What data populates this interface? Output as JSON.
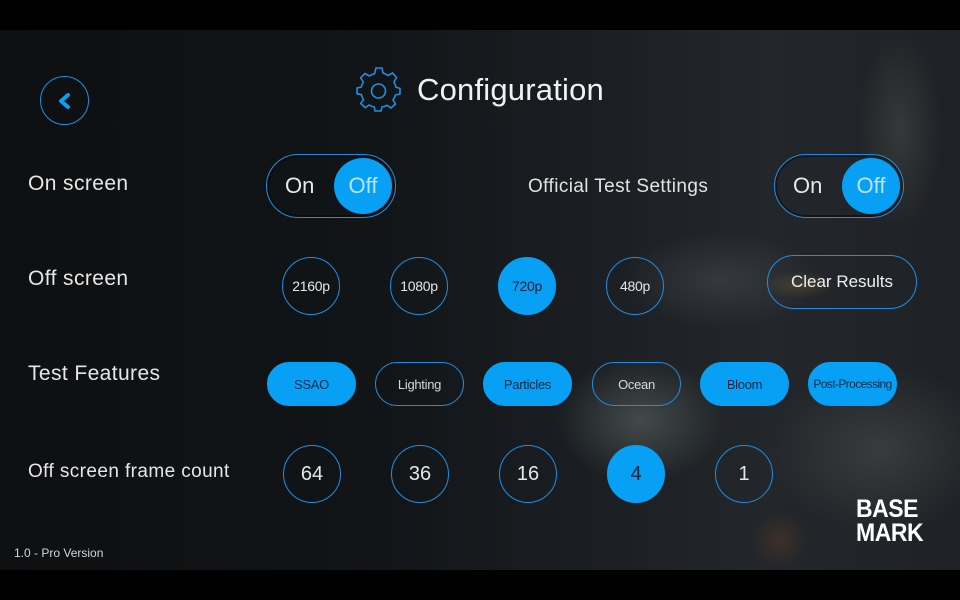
{
  "header": {
    "title": "Configuration",
    "back_icon": "chevron-left-icon",
    "title_icon": "gear-icon"
  },
  "colors": {
    "accent": "#07a0f5",
    "outline": "#1e8fe0",
    "text": "#e8e8e8"
  },
  "on_screen": {
    "label": "On screen",
    "on_label": "On",
    "off_label": "Off",
    "value": "Off"
  },
  "official_test_settings": {
    "label": "Official Test Settings",
    "on_label": "On",
    "off_label": "Off",
    "value": "Off"
  },
  "off_screen": {
    "label": "Off screen",
    "options": [
      {
        "label": "2160p",
        "selected": false
      },
      {
        "label": "1080p",
        "selected": false
      },
      {
        "label": "720p",
        "selected": true
      },
      {
        "label": "480p",
        "selected": false
      }
    ]
  },
  "clear_results": {
    "label": "Clear Results"
  },
  "test_features": {
    "label": "Test Features",
    "options": [
      {
        "label": "SSAO",
        "selected": true
      },
      {
        "label": "Lighting",
        "selected": false
      },
      {
        "label": "Particles",
        "selected": true
      },
      {
        "label": "Ocean",
        "selected": false
      },
      {
        "label": "Bloom",
        "selected": true
      },
      {
        "label": "Post-Processing",
        "selected": true
      }
    ]
  },
  "frame_count": {
    "label": "Off screen frame count",
    "options": [
      {
        "label": "64",
        "selected": false
      },
      {
        "label": "36",
        "selected": false
      },
      {
        "label": "16",
        "selected": false
      },
      {
        "label": "4",
        "selected": true
      },
      {
        "label": "1",
        "selected": false
      }
    ]
  },
  "footer": {
    "version": "1.0 - Pro Version",
    "logo_line1": "BASE",
    "logo_line2": "MARK"
  }
}
